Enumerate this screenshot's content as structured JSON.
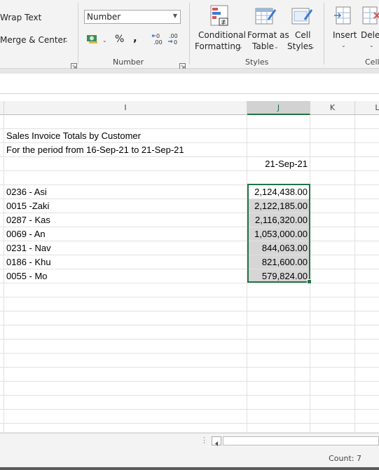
{
  "ribbon": {
    "alignment": {
      "wrap_text": "Wrap Text",
      "merge_center": "Merge & Center"
    },
    "number": {
      "format_value": "Number",
      "percent_symbol": "%",
      "comma_symbol": ",",
      "increase_decimal": "←0 .00",
      "decrease_decimal": ".00 →0",
      "group_label": "Number"
    },
    "styles": {
      "conditional_formatting": [
        "Conditional",
        "Formatting"
      ],
      "format_as_table": [
        "Format as",
        "Table"
      ],
      "cell_styles": [
        "Cell",
        "Styles"
      ],
      "group_label": "Styles"
    },
    "cells": {
      "insert": "Insert",
      "delete": "Delete",
      "group_label": "Cells"
    }
  },
  "sheet": {
    "columns": [
      {
        "label": "",
        "key": "H"
      },
      {
        "label": "I",
        "key": "I"
      },
      {
        "label": "J",
        "key": "J"
      },
      {
        "label": "K",
        "key": "K"
      },
      {
        "label": "L",
        "key": "L"
      }
    ],
    "selected_column": "J",
    "rows": [
      {
        "i": "",
        "j": ""
      },
      {
        "i": "Sales Invoice Totals by Customer",
        "j": ""
      },
      {
        "i": "For the period from 16-Sep-21 to 21-Sep-21",
        "j": ""
      },
      {
        "i": "",
        "j": "21-Sep-21"
      },
      {
        "i": "",
        "j": ""
      },
      {
        "i": "0236 - Asi",
        "j": "2,124,438.00"
      },
      {
        "i": "0015 -Zaki",
        "j": "2,122,185.00"
      },
      {
        "i": "0287 - Kas",
        "j": "2,116,320.00"
      },
      {
        "i": "0069 - An",
        "j": "1,053,000.00"
      },
      {
        "i": "0231 - Nav",
        "j": "844,063.00"
      },
      {
        "i": "0186 - Khu",
        "j": "821,600.00"
      },
      {
        "i": "0055 - Mo",
        "j": "579,824.00"
      },
      {
        "i": "",
        "j": ""
      },
      {
        "i": "",
        "j": ""
      },
      {
        "i": "",
        "j": ""
      },
      {
        "i": "",
        "j": ""
      },
      {
        "i": "",
        "j": ""
      },
      {
        "i": "",
        "j": ""
      },
      {
        "i": "",
        "j": ""
      },
      {
        "i": "",
        "j": ""
      },
      {
        "i": "",
        "j": ""
      },
      {
        "i": "",
        "j": ""
      },
      {
        "i": "",
        "j": ""
      },
      {
        "i": "",
        "j": ""
      }
    ]
  },
  "status_bar": {
    "count": "Count: 7"
  },
  "colors": {
    "accent": "#217346",
    "selection_fill": "#d6d6d6"
  }
}
